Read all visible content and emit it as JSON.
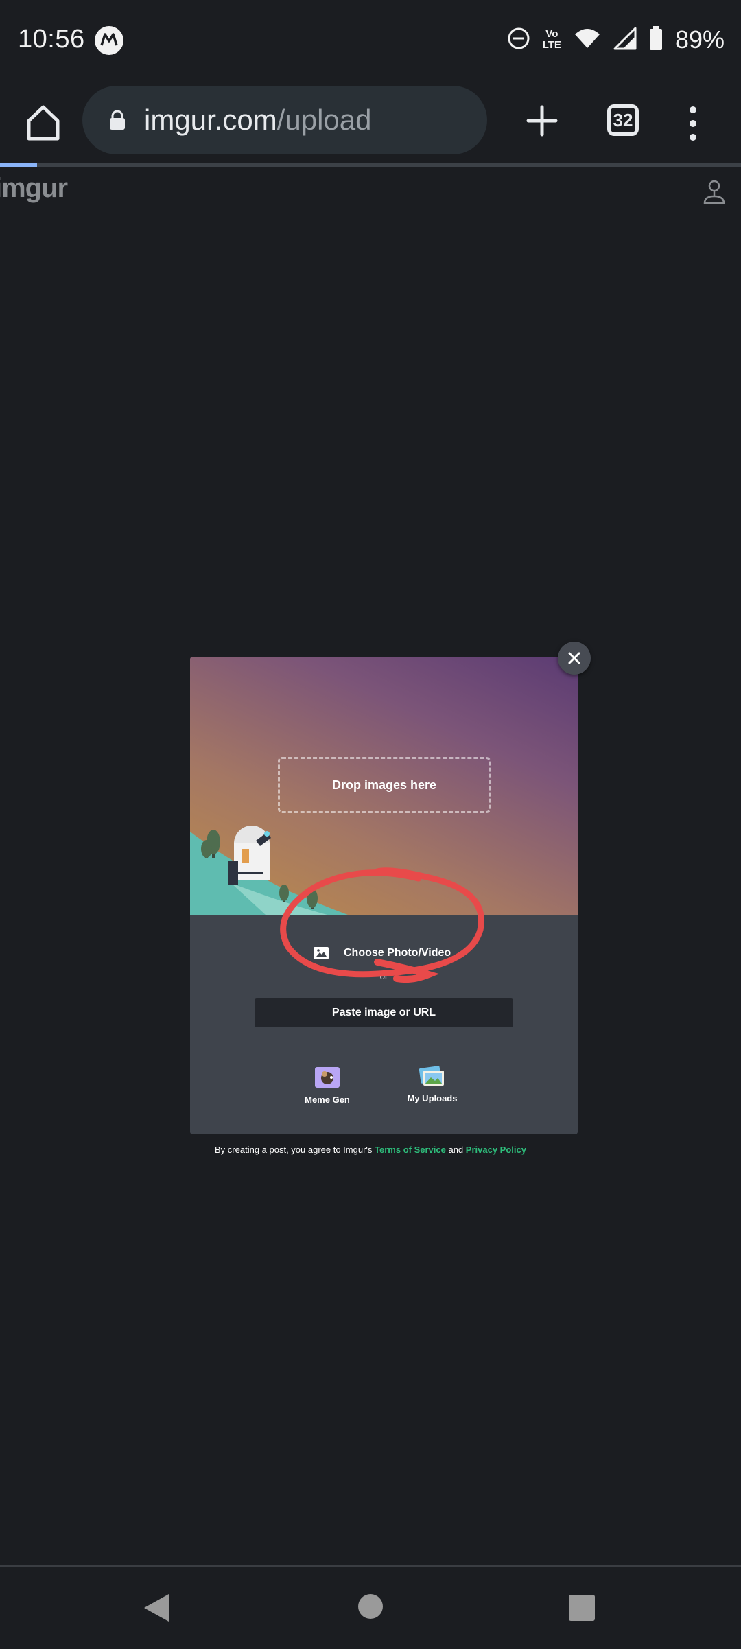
{
  "status_bar": {
    "time": "10:56",
    "volte_top": "Vo",
    "volte_bottom": "LTE",
    "battery_percent": "89%",
    "icons": [
      "motorola-logo-icon",
      "do-not-disturb-icon",
      "volte-icon",
      "wifi-icon",
      "cell-signal-icon",
      "battery-icon"
    ]
  },
  "browser": {
    "url_host": "imgur.com",
    "url_path": "/upload",
    "tab_count": "32",
    "page_load_progress": 0.05,
    "icons": [
      "home-icon",
      "lock-icon",
      "new-tab-icon",
      "tab-switcher-icon",
      "more-menu-icon"
    ]
  },
  "site": {
    "logo": "imgur",
    "account_icon": "account-icon"
  },
  "upload_modal": {
    "drop_zone_label": "Drop images here",
    "choose_button_label": "Choose Photo/Video",
    "or_label": "or",
    "paste_button_label": "Paste image or URL",
    "tools": [
      {
        "label": "Meme Gen",
        "icon": "meme-gen-icon"
      },
      {
        "label": "My Uploads",
        "icon": "my-uploads-icon"
      }
    ],
    "close_icon": "close-icon",
    "photo_icon": "photo-icon"
  },
  "terms": {
    "prefix": "By creating a post, you agree to Imgur's",
    "tos_link": "Terms of Service",
    "and": "and",
    "privacy_link": "Privacy Policy"
  },
  "colors": {
    "background": "#1b1d21",
    "modal": "#3f444c",
    "paste_button": "#23262c",
    "link_green": "#2ebd7b",
    "annotation_red": "#e84a4a"
  },
  "nav_bar": {
    "icons": [
      "back-icon",
      "home-circle-icon",
      "recents-icon"
    ]
  }
}
